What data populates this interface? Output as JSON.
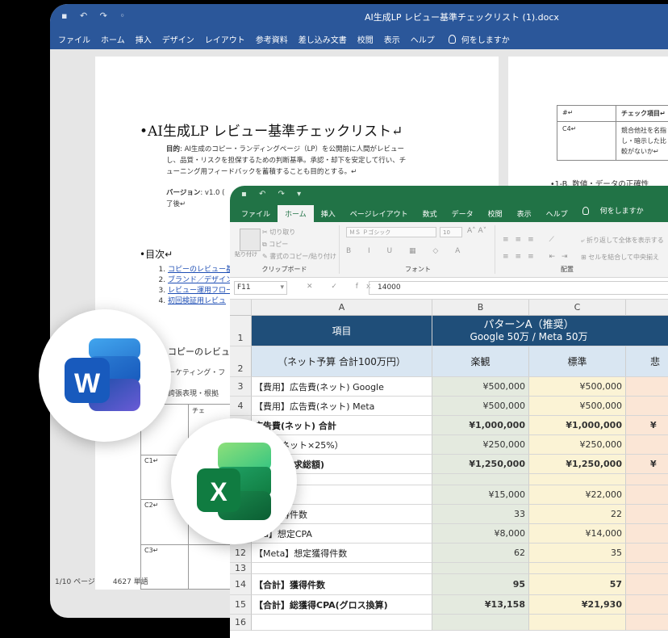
{
  "word": {
    "title": "AI生成LP レビュー基準チェックリスト (1).docx",
    "menu": [
      "ファイル",
      "ホーム",
      "挿入",
      "デザイン",
      "レイアウト",
      "参考資料",
      "差し込み文書",
      "校閲",
      "表示",
      "ヘルプ"
    ],
    "tell_me": "何をしますか",
    "doc_title": "AI生成LP レビュー基準チェックリスト↵",
    "purpose_label": "目的",
    "purpose_lines": [
      ": AI生成のコピー・ランディングページ（LP）を公開前に人間がレビュー",
      "し、品質・リスクを担保するための判断基準。承認・却下を安定して行い、チ",
      "ューニング用フィードバックを蓄積することも目的とする。↵"
    ],
    "version_label": "バージョン",
    "version_value": ": v1.0 (",
    "version_tail": "了後↵",
    "toc_heading": "目次↵",
    "toc_items": [
      "コピーのレビュー基",
      "ブランド／デザイン",
      "レビュー運用フロー",
      "初回検証用レビュ"
    ],
    "section_heading": "コピーのレビュ",
    "section_sub": "ーケティング・フ",
    "section_sub2": "誇張表現・根拠",
    "table_header": "チェ",
    "table_rows": [
      "C1↵",
      "C2↵",
      "C3↵"
    ],
    "status_page": "1/10 ページ",
    "status_words": "4627 単語",
    "page2": {
      "table_headers": [
        "#↵",
        "チェック項目↵"
      ],
      "table_row_id": "C4↵",
      "table_row_text": [
        "競合他社を名指",
        "し・暗示した比",
        "較がないか↵"
      ],
      "section": "1-B. 数値・データの正確性"
    }
  },
  "excel": {
    "menu": [
      "ファイル",
      "ホーム",
      "挿入",
      "ページレイアウト",
      "数式",
      "データ",
      "校閲",
      "表示",
      "ヘルプ"
    ],
    "active_tab": "ホーム",
    "tell_me": "何をしますか",
    "ribbon": {
      "paste": "貼り付け",
      "cut": "切り取り",
      "copy": "コピー",
      "format_painter": "書式のコピー/貼り付け",
      "clipboard_label": "クリップボード",
      "font_name": "ＭＳ Ｐゴシック",
      "font_size": "10",
      "font_label": "フォント",
      "wrap": "折り返して全体を表示する",
      "merge": "セルを結合して中央揃え",
      "align_label": "配置"
    },
    "name_box": "F11",
    "formula_value": "14000",
    "columns": [
      "A",
      "B",
      "C"
    ],
    "header": {
      "row1_a": "項目",
      "row1_bc_line1": "パターンA（推奨）",
      "row1_bc_line2": "Google 50万 / Meta 50万",
      "row2_a": "（ネット予算 合計100万円）",
      "row2_b": "楽観",
      "row2_c": "標準",
      "row2_d": "悲"
    },
    "rows": [
      {
        "n": "3",
        "a": "【費用】広告費(ネット) Google",
        "b": "¥500,000",
        "c": "¥500,000",
        "d": "",
        "bold": false
      },
      {
        "n": "4",
        "a": "【費用】広告費(ネット) Meta",
        "b": "¥500,000",
        "c": "¥500,000",
        "d": "",
        "bold": false
      },
      {
        "n": "5",
        "a": "広告費(ネット) 合計",
        "b": "¥1,000,000",
        "c": "¥1,000,000",
        "d": "¥",
        "bold": true
      },
      {
        "n": "6",
        "a": "数料（ネット×25%）",
        "b": "¥250,000",
        "c": "¥250,000",
        "d": "",
        "bold": false
      },
      {
        "n": "7",
        "a": "ス合計(請求総額)",
        "b": "¥1,250,000",
        "c": "¥1,250,000",
        "d": "¥",
        "bold": true
      },
      {
        "n": "8",
        "a": "",
        "b": "",
        "c": "",
        "d": "",
        "bold": false
      },
      {
        "n": "9",
        "a": "定CPA",
        "b": "¥15,000",
        "c": "¥22,000",
        "d": "",
        "bold": false
      },
      {
        "n": "10",
        "a": "想定獲得件数",
        "b": "33",
        "c": "22",
        "d": "",
        "bold": false
      },
      {
        "n": "11",
        "a": "eta】想定CPA",
        "b": "¥8,000",
        "c": "¥14,000",
        "d": "",
        "bold": false
      },
      {
        "n": "12",
        "a": "【Meta】想定獲得件数",
        "b": "62",
        "c": "35",
        "d": "",
        "bold": false
      },
      {
        "n": "13",
        "a": "",
        "b": "",
        "c": "",
        "d": "",
        "bold": false
      },
      {
        "n": "14",
        "a": "【合計】獲得件数",
        "b": "95",
        "c": "57",
        "d": "",
        "bold": true
      },
      {
        "n": "15",
        "a": "【合計】総獲得CPA(グロス換算)",
        "b": "¥13,158",
        "c": "¥21,930",
        "d": "",
        "bold": true
      },
      {
        "n": "16",
        "a": "",
        "b": "",
        "c": "",
        "d": "",
        "bold": false
      }
    ],
    "row_numbers_head": [
      "1",
      "2"
    ]
  },
  "logos": {
    "word_letter": "W",
    "excel_letter": "X",
    "word_color": "#185abd",
    "excel_color": "#107c41"
  }
}
